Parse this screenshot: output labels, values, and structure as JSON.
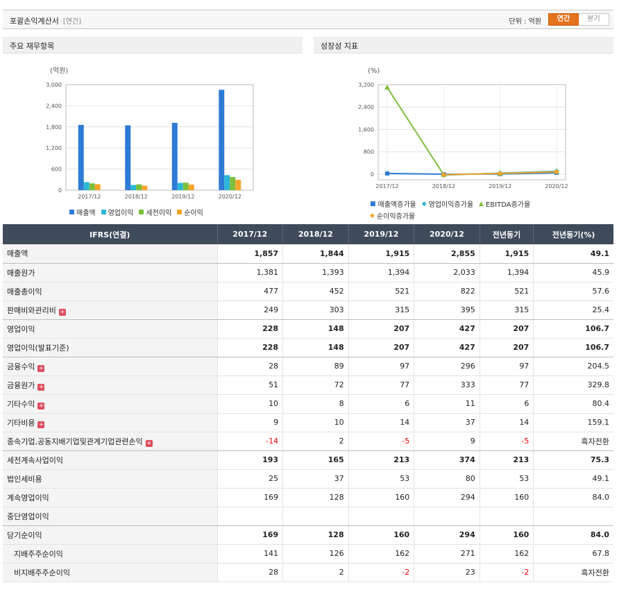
{
  "header": {
    "title": "포괄손익계산서",
    "subtitle": "[연간]",
    "unit_label": "단위 : 억원",
    "tab_annual": "연간",
    "tab_quarter": "분기"
  },
  "panels": {
    "left_title": "주요 재무항목",
    "right_title": "성장성 지표"
  },
  "chart_data": [
    {
      "type": "bar",
      "ylabel": "(억원)",
      "categories": [
        "2017/12",
        "2018/12",
        "2019/12",
        "2020/12"
      ],
      "ylim": [
        0,
        3000
      ],
      "yticks": [
        0,
        600,
        1200,
        1800,
        2400,
        3000
      ],
      "ytick_labels": [
        "0",
        "600",
        "1,200",
        "1,800",
        "2,400",
        "3,000"
      ],
      "series": [
        {
          "name": "매출액",
          "color": "#2e7bd6",
          "values": [
            1857,
            1844,
            1915,
            2855
          ]
        },
        {
          "name": "영업이익",
          "color": "#2bb7d6",
          "values": [
            228,
            148,
            207,
            427
          ]
        },
        {
          "name": "세전이익",
          "color": "#7cbf3c",
          "values": [
            193,
            165,
            213,
            374
          ]
        },
        {
          "name": "순이익",
          "color": "#f5a52b",
          "values": [
            169,
            128,
            160,
            294
          ]
        }
      ],
      "legend_position": "bottom",
      "grid": true
    },
    {
      "type": "line",
      "ylabel": "(%)",
      "categories": [
        "2017/12",
        "2018/12",
        "2019/12",
        "2020/12"
      ],
      "ylim": [
        -200,
        3200
      ],
      "yticks": [
        0,
        800,
        1600,
        2400,
        3200
      ],
      "ytick_labels": [
        "0",
        "800",
        "1,600",
        "2,400",
        "3,200"
      ],
      "series": [
        {
          "name": "매출액증가율",
          "color": "#2e7bd6",
          "marker": "square",
          "values": [
            25,
            -1,
            4,
            49
          ]
        },
        {
          "name": "영업이익증가율",
          "color": "#2bb7d6",
          "marker": "diamond",
          "values": [
            null,
            -35,
            40,
            106
          ]
        },
        {
          "name": "EBITDA증가율",
          "color": "#7cbf3c",
          "marker": "triangle",
          "values": [
            3100,
            -20,
            30,
            90
          ]
        },
        {
          "name": "순이익증가율",
          "color": "#f5a52b",
          "marker": "diamond",
          "values": [
            null,
            -24,
            25,
            84
          ]
        }
      ],
      "legend_position": "bottom",
      "grid": true
    }
  ],
  "table": {
    "headers": [
      "IFRS(연결)",
      "2017/12",
      "2018/12",
      "2019/12",
      "2020/12",
      "전년동기",
      "전년동기(%)"
    ],
    "rows": [
      {
        "label": "매출액",
        "cells": [
          "1,857",
          "1,844",
          "1,915",
          "2,855",
          "1,915",
          "49.1"
        ]
      },
      {
        "label": "매출원가",
        "cells": [
          "1,381",
          "1,393",
          "1,394",
          "2,033",
          "1,394",
          "45.9"
        ]
      },
      {
        "label": "매출총이익",
        "cells": [
          "477",
          "452",
          "521",
          "822",
          "521",
          "57.6"
        ]
      },
      {
        "label": "판매비와관리비",
        "cells": [
          "249",
          "303",
          "315",
          "395",
          "315",
          "25.4"
        ]
      },
      {
        "label": "영업이익",
        "cells": [
          "228",
          "148",
          "207",
          "427",
          "207",
          "106.7"
        ]
      },
      {
        "label": "영업이익(발표기준)",
        "cells": [
          "228",
          "148",
          "207",
          "427",
          "207",
          "106.7"
        ]
      },
      {
        "label": "금융수익",
        "cells": [
          "28",
          "89",
          "97",
          "296",
          "97",
          "204.5"
        ]
      },
      {
        "label": "금융원가",
        "cells": [
          "51",
          "72",
          "77",
          "333",
          "77",
          "329.8"
        ]
      },
      {
        "label": "기타수익",
        "cells": [
          "10",
          "8",
          "6",
          "11",
          "6",
          "80.4"
        ]
      },
      {
        "label": "기타비용",
        "cells": [
          "9",
          "10",
          "14",
          "37",
          "14",
          "159.1"
        ]
      },
      {
        "label": "종속기업,공동지배기업및관계기업관련손익",
        "cells": [
          "-14",
          "2",
          "-5",
          "9",
          "-5",
          "흑자전환"
        ]
      },
      {
        "label": "세전계속사업이익",
        "cells": [
          "193",
          "165",
          "213",
          "374",
          "213",
          "75.3"
        ]
      },
      {
        "label": "법인세비용",
        "cells": [
          "25",
          "37",
          "53",
          "80",
          "53",
          "49.1"
        ]
      },
      {
        "label": "계속영업이익",
        "cells": [
          "169",
          "128",
          "160",
          "294",
          "160",
          "84.0"
        ]
      },
      {
        "label": "중단영업이익",
        "cells": [
          "",
          "",
          "",
          "",
          "",
          ""
        ]
      },
      {
        "label": "당기순이익",
        "cells": [
          "169",
          "128",
          "160",
          "294",
          "160",
          "84.0"
        ]
      },
      {
        "label": "지배주주순이익",
        "cells": [
          "141",
          "126",
          "162",
          "271",
          "162",
          "67.8"
        ]
      },
      {
        "label": "비지배주주순이익",
        "cells": [
          "28",
          "2",
          "-2",
          "23",
          "-2",
          "흑자전환"
        ]
      }
    ]
  }
}
